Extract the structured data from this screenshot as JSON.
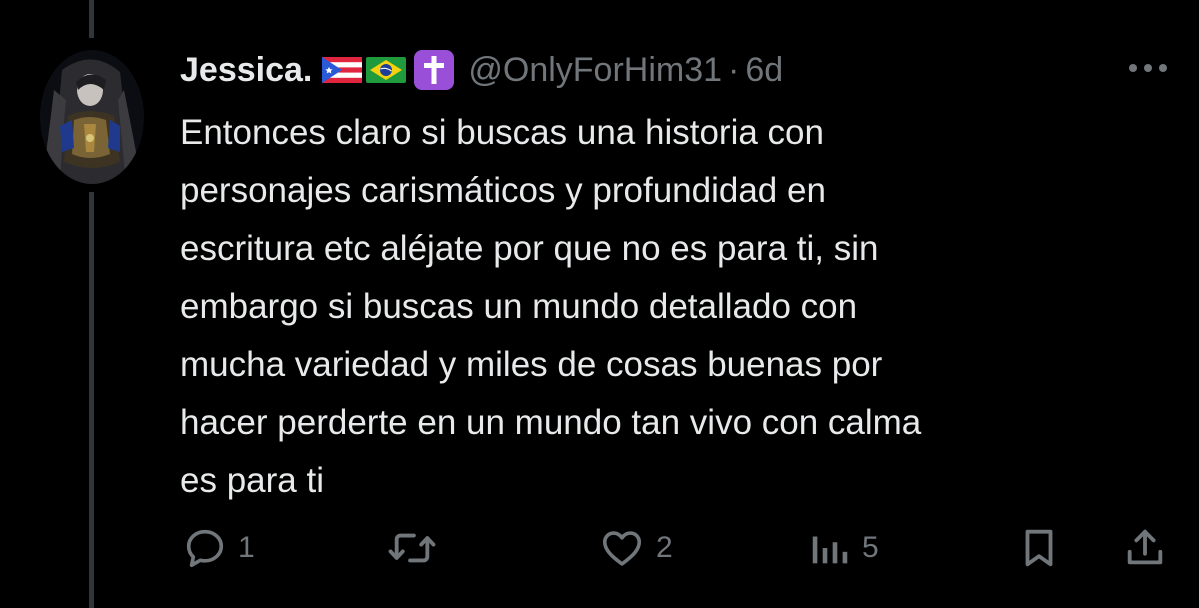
{
  "tweet": {
    "display_name": "Jessica.",
    "handle": "@OnlyForHim31",
    "separator": "·",
    "time": "6d",
    "text": "Entonces claro si buscas una historia con\npersonajes carismáticos y profundidad en\nescritura etc aléjate por que no es para ti, sin\nembargo si buscas un mundo detallado con\nmucha variedad y miles de cosas buenas por\nhacer perderte en un mundo tan vivo con calma\nes para ti",
    "badges": [
      "puerto-rico-flag-icon",
      "brazil-flag-icon",
      "latin-cross-icon"
    ]
  },
  "actions": {
    "reply_count": "1",
    "retweet_count": "",
    "like_count": "2",
    "views_count": "5"
  },
  "colors": {
    "background": "#000000",
    "primary_text": "#e7e9ea",
    "secondary_text": "#71767b",
    "thread_line": "#333639",
    "cross_badge": "#9a4fd8"
  }
}
